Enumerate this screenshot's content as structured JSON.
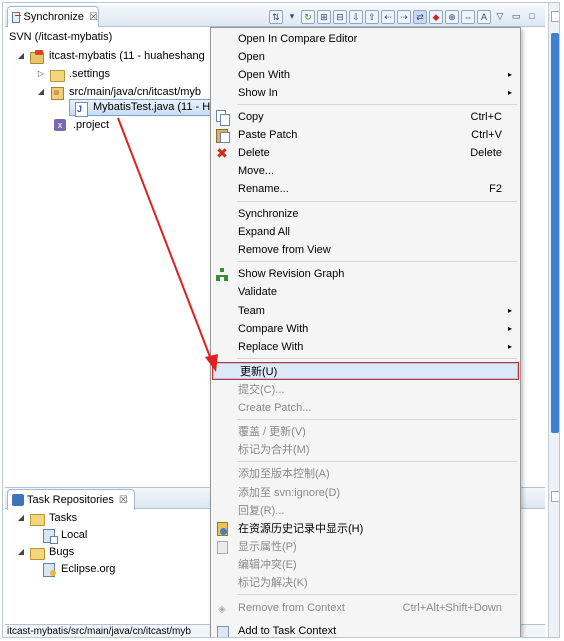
{
  "sync_view": {
    "tab_label": "Synchronize",
    "tab_close": "☒",
    "svn_path": "SVN (/itcast-mybatis)",
    "tree": [
      {
        "label": "itcast-mybatis (11 - huaheshang",
        "icon": "project-icon",
        "twisty": "◢"
      },
      {
        "label": ".settings",
        "icon": "folder-icon",
        "twisty": "▷"
      },
      {
        "label": "src/main/java/cn/itcast/myb",
        "icon": "package-icon",
        "twisty": "◢"
      },
      {
        "label": "MybatisTest.java (11 - H",
        "icon": "java-file-icon",
        "twisty": ""
      },
      {
        "label": ".project",
        "icon": "xml-file-icon",
        "twisty": ""
      }
    ]
  },
  "task_view": {
    "tab_label": "Task Repositories",
    "tab_close": "☒",
    "tree": [
      {
        "label": "Tasks",
        "icon": "folder-icon",
        "twisty": "◢"
      },
      {
        "label": "Local",
        "icon": "task-repo-icon",
        "twisty": ""
      },
      {
        "label": "Bugs",
        "icon": "folder-icon",
        "twisty": "◢"
      },
      {
        "label": "Eclipse.org",
        "icon": "bug-repo-icon",
        "twisty": ""
      }
    ]
  },
  "status_bar": {
    "text": "itcast-mybatis/src/main/java/cn/itcast/myb"
  },
  "context_menu": {
    "items": [
      {
        "label": "Open In Compare Editor"
      },
      {
        "label": "Open"
      },
      {
        "label": "Open With",
        "submenu": "▸"
      },
      {
        "label": "Show In",
        "submenu": "▸"
      },
      {
        "label": "Copy",
        "accel": "Ctrl+C",
        "icon": "copy-icon"
      },
      {
        "label": "Paste Patch",
        "accel": "Ctrl+V",
        "icon": "paste-icon"
      },
      {
        "label": "Delete",
        "accel": "Delete",
        "icon": "delete-icon"
      },
      {
        "label": "Move..."
      },
      {
        "label": "Rename...",
        "accel": "F2"
      },
      {
        "label": "Synchronize"
      },
      {
        "label": "Expand All"
      },
      {
        "label": "Remove from View"
      },
      {
        "label": "Show Revision Graph",
        "icon": "revision-graph-icon"
      },
      {
        "label": "Validate"
      },
      {
        "label": "Team",
        "submenu": "▸"
      },
      {
        "label": "Compare With",
        "submenu": "▸"
      },
      {
        "label": "Replace With",
        "submenu": "▸"
      },
      {
        "label": "更新(U)"
      },
      {
        "label": "提交(C)..."
      },
      {
        "label": "Create Patch..."
      },
      {
        "label": "覆盖 / 更新(V)"
      },
      {
        "label": "标记为合并(M)"
      },
      {
        "label": "添加至版本控制(A)"
      },
      {
        "label": "添加至 svn:ignore(D)"
      },
      {
        "label": "回复(R)..."
      },
      {
        "label": "在资源历史记录中显示(H)",
        "icon": "history-icon"
      },
      {
        "label": "显示属性(P)",
        "icon": "properties-icon"
      },
      {
        "label": "编辑冲突(E)"
      },
      {
        "label": "标记为解决(K)"
      },
      {
        "label": "Remove from Context",
        "accel": "Ctrl+Alt+Shift+Down",
        "icon": "context-icon"
      },
      {
        "label": "Add to Task Context",
        "icon": "task-context-icon"
      }
    ]
  },
  "colors": {
    "highlight_border": "#d12b2b",
    "arrow": "#e02020"
  }
}
